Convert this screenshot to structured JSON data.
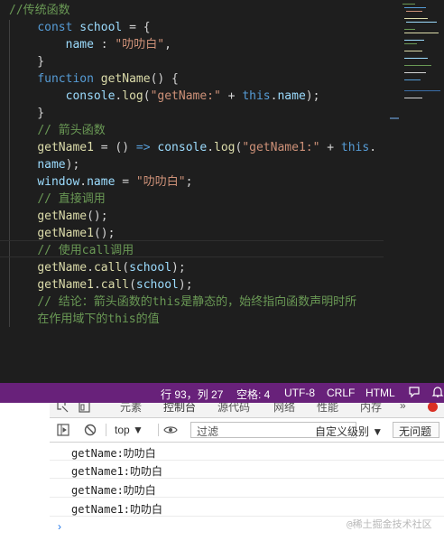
{
  "editor": {
    "lines": [
      [
        {
          "t": "//传统函数",
          "c": "c"
        }
      ],
      [
        {
          "t": "    ",
          "c": "d"
        },
        {
          "t": "const",
          "c": "k"
        },
        {
          "t": " ",
          "c": "d"
        },
        {
          "t": "school",
          "c": "v"
        },
        {
          "t": " = {",
          "c": "d"
        }
      ],
      [
        {
          "t": "        ",
          "c": "d"
        },
        {
          "t": "name",
          "c": "v"
        },
        {
          "t": " : ",
          "c": "d"
        },
        {
          "t": "\"叻叻白\"",
          "c": "s"
        },
        {
          "t": ",",
          "c": "d"
        }
      ],
      [
        {
          "t": "    }",
          "c": "d"
        }
      ],
      [
        {
          "t": "    ",
          "c": "d"
        },
        {
          "t": "function",
          "c": "k"
        },
        {
          "t": " ",
          "c": "d"
        },
        {
          "t": "getName",
          "c": "f"
        },
        {
          "t": "() {",
          "c": "d"
        }
      ],
      [
        {
          "t": "        ",
          "c": "d"
        },
        {
          "t": "console",
          "c": "v"
        },
        {
          "t": ".",
          "c": "d"
        },
        {
          "t": "log",
          "c": "f"
        },
        {
          "t": "(",
          "c": "d"
        },
        {
          "t": "\"getName:\"",
          "c": "s"
        },
        {
          "t": " + ",
          "c": "d"
        },
        {
          "t": "this",
          "c": "k"
        },
        {
          "t": ".",
          "c": "d"
        },
        {
          "t": "name",
          "c": "v"
        },
        {
          "t": ");",
          "c": "d"
        }
      ],
      [
        {
          "t": "    }",
          "c": "d"
        }
      ],
      [
        {
          "t": "    ",
          "c": "d"
        },
        {
          "t": "// 箭头函数",
          "c": "c"
        }
      ],
      [
        {
          "t": "    ",
          "c": "d"
        },
        {
          "t": "getName1",
          "c": "f"
        },
        {
          "t": " = () ",
          "c": "d"
        },
        {
          "t": "=>",
          "c": "k"
        },
        {
          "t": " ",
          "c": "d"
        },
        {
          "t": "console",
          "c": "v"
        },
        {
          "t": ".",
          "c": "d"
        },
        {
          "t": "log",
          "c": "f"
        },
        {
          "t": "(",
          "c": "d"
        },
        {
          "t": "\"getName1:\"",
          "c": "s"
        },
        {
          "t": " + ",
          "c": "d"
        },
        {
          "t": "this",
          "c": "k"
        },
        {
          "t": ".",
          "c": "d"
        }
      ],
      [
        {
          "t": "    ",
          "c": "d"
        },
        {
          "t": "name",
          "c": "v"
        },
        {
          "t": ");",
          "c": "d"
        }
      ],
      [
        {
          "t": "    ",
          "c": "d"
        },
        {
          "t": "window",
          "c": "v"
        },
        {
          "t": ".",
          "c": "d"
        },
        {
          "t": "name",
          "c": "v"
        },
        {
          "t": " = ",
          "c": "d"
        },
        {
          "t": "\"叻叻白\"",
          "c": "s"
        },
        {
          "t": ";",
          "c": "d"
        }
      ],
      [
        {
          "t": "    ",
          "c": "d"
        },
        {
          "t": "// 直接调用",
          "c": "c"
        }
      ],
      [
        {
          "t": "    ",
          "c": "d"
        },
        {
          "t": "getName",
          "c": "f"
        },
        {
          "t": "();",
          "c": "d"
        }
      ],
      [
        {
          "t": "    ",
          "c": "d"
        },
        {
          "t": "getName1",
          "c": "f"
        },
        {
          "t": "();",
          "c": "d"
        }
      ],
      [
        {
          "t": "    ",
          "c": "d"
        },
        {
          "t": "// 使用call调用",
          "c": "c"
        }
      ],
      [
        {
          "t": "    ",
          "c": "d"
        },
        {
          "t": "getName",
          "c": "f"
        },
        {
          "t": ".",
          "c": "d"
        },
        {
          "t": "call",
          "c": "f"
        },
        {
          "t": "(",
          "c": "d"
        },
        {
          "t": "school",
          "c": "v"
        },
        {
          "t": ");",
          "c": "d"
        }
      ],
      [
        {
          "t": "    ",
          "c": "d"
        },
        {
          "t": "getName1",
          "c": "f"
        },
        {
          "t": ".",
          "c": "d"
        },
        {
          "t": "call",
          "c": "f"
        },
        {
          "t": "(",
          "c": "d"
        },
        {
          "t": "school",
          "c": "v"
        },
        {
          "t": ");",
          "c": "d"
        }
      ],
      [
        {
          "t": "    ",
          "c": "d"
        },
        {
          "t": "// 结论：箭头函数的this是静态的，始终指向函数声明时所",
          "c": "c"
        }
      ],
      [
        {
          "t": "    ",
          "c": "d"
        },
        {
          "t": "在作用域下的this的值",
          "c": "c"
        }
      ]
    ]
  },
  "statusbar": {
    "position": "行 93，列 27",
    "spaces": "空格: 4",
    "encoding": "UTF-8",
    "eol": "CRLF",
    "language": "HTML"
  },
  "devtools": {
    "tabs": [
      "元素",
      "控制台",
      "源代码",
      "网络",
      "性能",
      "内存"
    ],
    "more": "»",
    "context": "top",
    "filter_placeholder": "过滤",
    "level": "自定义级别 ▼",
    "issues": "无问题",
    "logs": [
      "getName:叻叻白",
      "getName1:叻叻白",
      "getName:叻叻白",
      "getName1:叻叻白"
    ],
    "prompt": "›"
  },
  "watermark": "@稀土掘金技术社区",
  "colors": {
    "statusbar": "#68217a",
    "keyword": "#569cd6",
    "comment": "#6a9955",
    "string": "#ce9178",
    "variable": "#9cdcfe",
    "function": "#dcdcaa"
  }
}
